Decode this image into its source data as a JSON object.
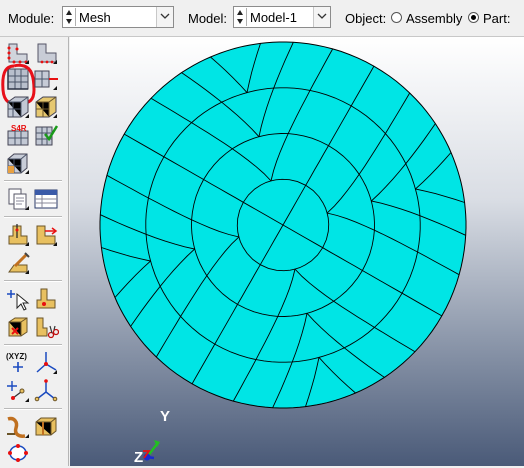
{
  "context_bar": {
    "module_label": "Module:",
    "module_value": "Mesh",
    "model_label": "Model:",
    "model_value": "Model-1",
    "object_label": "Object:",
    "assembly_option": "Assembly",
    "part_option": "Part:",
    "selected_object": "part"
  },
  "toolbox": {
    "seed_label": "S4R",
    "xyz_label": "(XYZ)",
    "highlighted_tool": "assign-mesh-controls",
    "highlight_color": "#e8101a"
  },
  "viewport": {
    "mesh_fill_color": "#00e5e5",
    "triad": {
      "y_label": "Y",
      "z_label": "Z"
    }
  }
}
